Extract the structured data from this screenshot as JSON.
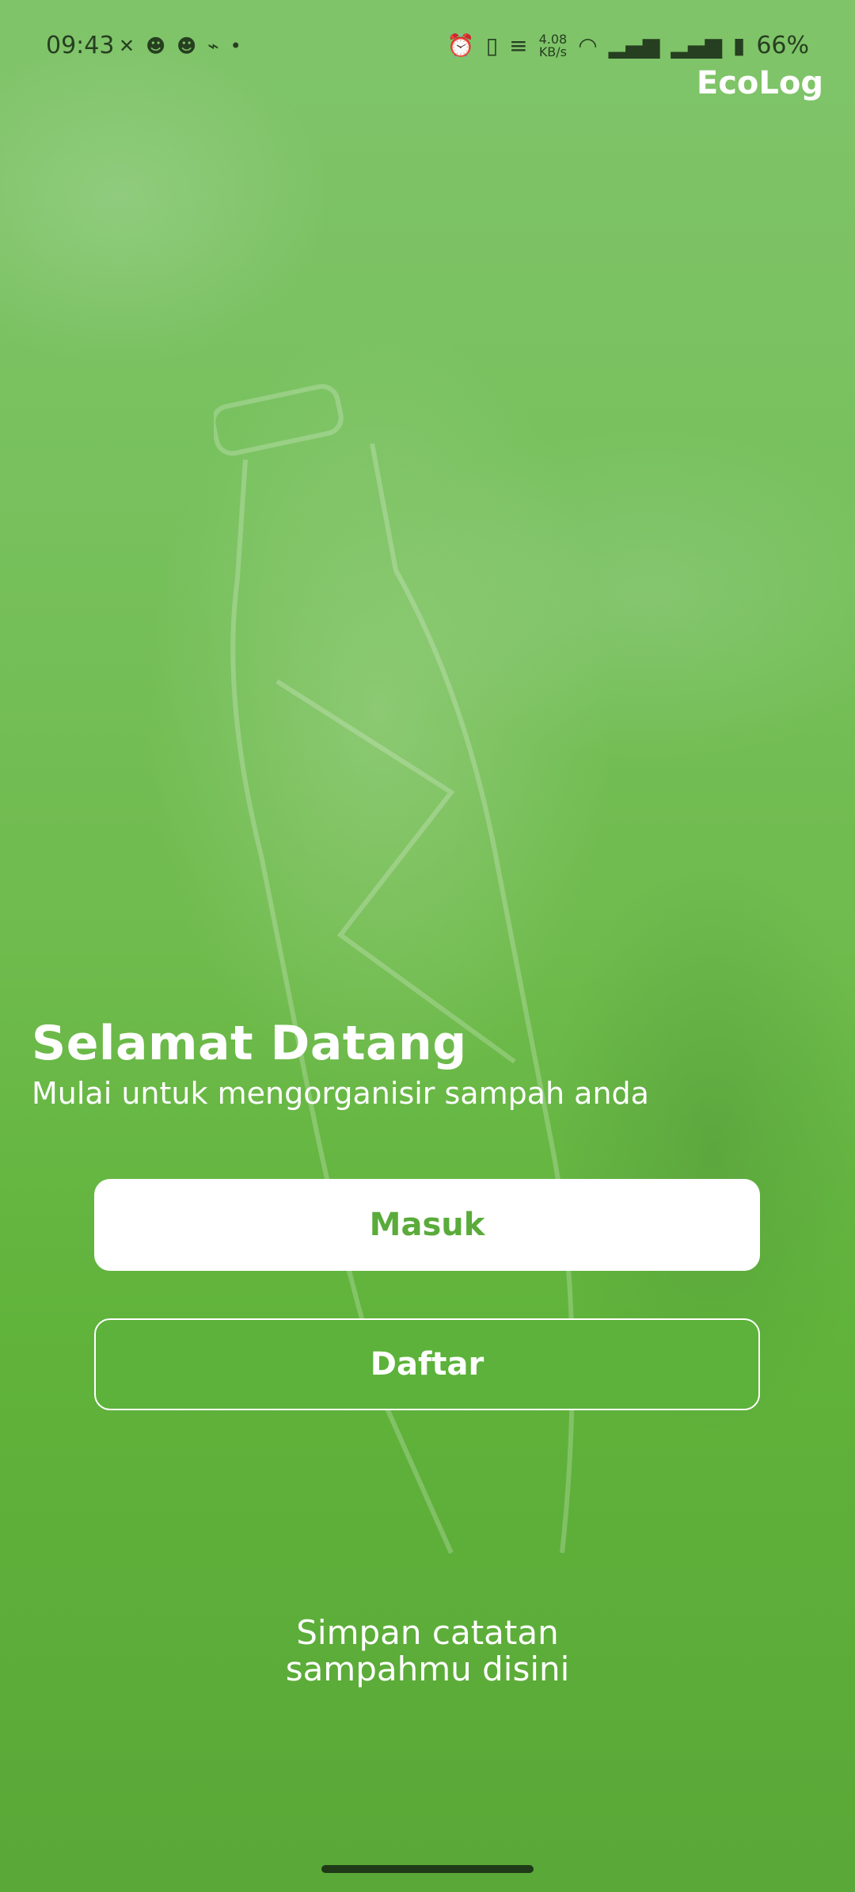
{
  "status_bar": {
    "time": "09:43",
    "speed_value": "4.08",
    "speed_unit": "KB/s",
    "battery": "66%",
    "icons_left": [
      "notification-icon",
      "game-icon",
      "game-icon",
      "controller-icon",
      "dot-icon"
    ],
    "icons_right": [
      "alarm-icon",
      "vibrate-icon",
      "network-logo-icon",
      "wifi-icon",
      "signal-icon",
      "signal-icon",
      "battery-charging-icon"
    ]
  },
  "app": {
    "title": "EcoLog"
  },
  "welcome": {
    "title": "Selamat Datang",
    "subtitle": "Mulai untuk mengorganisir sampah anda"
  },
  "buttons": {
    "login": "Masuk",
    "register": "Daftar"
  },
  "tagline": {
    "line1": "Simpan catatan",
    "line2": "sampahmu disini"
  },
  "colors": {
    "background": "#62b53f",
    "primary": "#5aab3b",
    "white": "#ffffff"
  }
}
